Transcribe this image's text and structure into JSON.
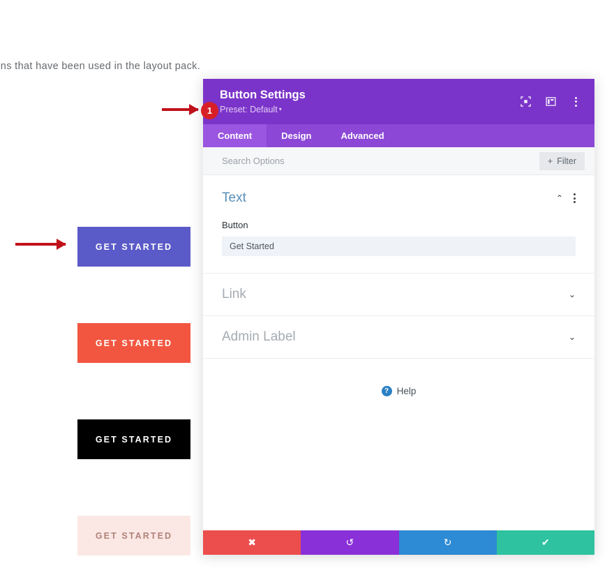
{
  "page": {
    "paragraph": "tons that have been used in the layout pack.",
    "cta_buttons": [
      {
        "label": "Get Started",
        "bg": "#5a5ac8",
        "color": "#ffffff"
      },
      {
        "label": "Get Started",
        "bg": "#f25640",
        "color": "#ffffff"
      },
      {
        "label": "Get Started",
        "bg": "#000000",
        "color": "#ffffff"
      },
      {
        "label": "Get Started",
        "bg": "#fbe8e5",
        "color": "#b08278"
      }
    ]
  },
  "annotation": {
    "badge_number": "1",
    "badge_color": "#d81f26",
    "arrow_color": "#c1121c"
  },
  "modal": {
    "title": "Button Settings",
    "preset_label": "Preset: Default",
    "preset_caret": "▾",
    "header_color": "#7b34c9",
    "header_icons": [
      {
        "name": "focus-target-icon"
      },
      {
        "name": "layout-panel-icon"
      },
      {
        "name": "more-options-icon"
      }
    ],
    "tabs": [
      {
        "label": "Content",
        "active": true
      },
      {
        "label": "Design",
        "active": false
      },
      {
        "label": "Advanced",
        "active": false
      }
    ],
    "search": {
      "placeholder": "Search Options",
      "value": ""
    },
    "filter_button": {
      "label": "Filter",
      "plus": "+"
    },
    "sections": [
      {
        "title": "Text",
        "state": "expanded",
        "collapse_caret": "⌃",
        "field_label": "Button",
        "field_value": "Get Started"
      },
      {
        "title": "Link",
        "state": "collapsed",
        "expand_caret": "⌄"
      },
      {
        "title": "Admin Label",
        "state": "collapsed",
        "expand_caret": "⌄"
      }
    ],
    "help": {
      "label": "Help",
      "icon_glyph": "?",
      "icon_color": "#2b80c4"
    },
    "footer_buttons": [
      {
        "name": "cancel",
        "glyph": "✖",
        "color": "#ec4e4e"
      },
      {
        "name": "undo",
        "glyph": "↺",
        "color": "#8a30d8"
      },
      {
        "name": "redo",
        "glyph": "↻",
        "color": "#2d8ad4"
      },
      {
        "name": "save",
        "glyph": "✔",
        "color": "#2ec2a0"
      }
    ]
  }
}
